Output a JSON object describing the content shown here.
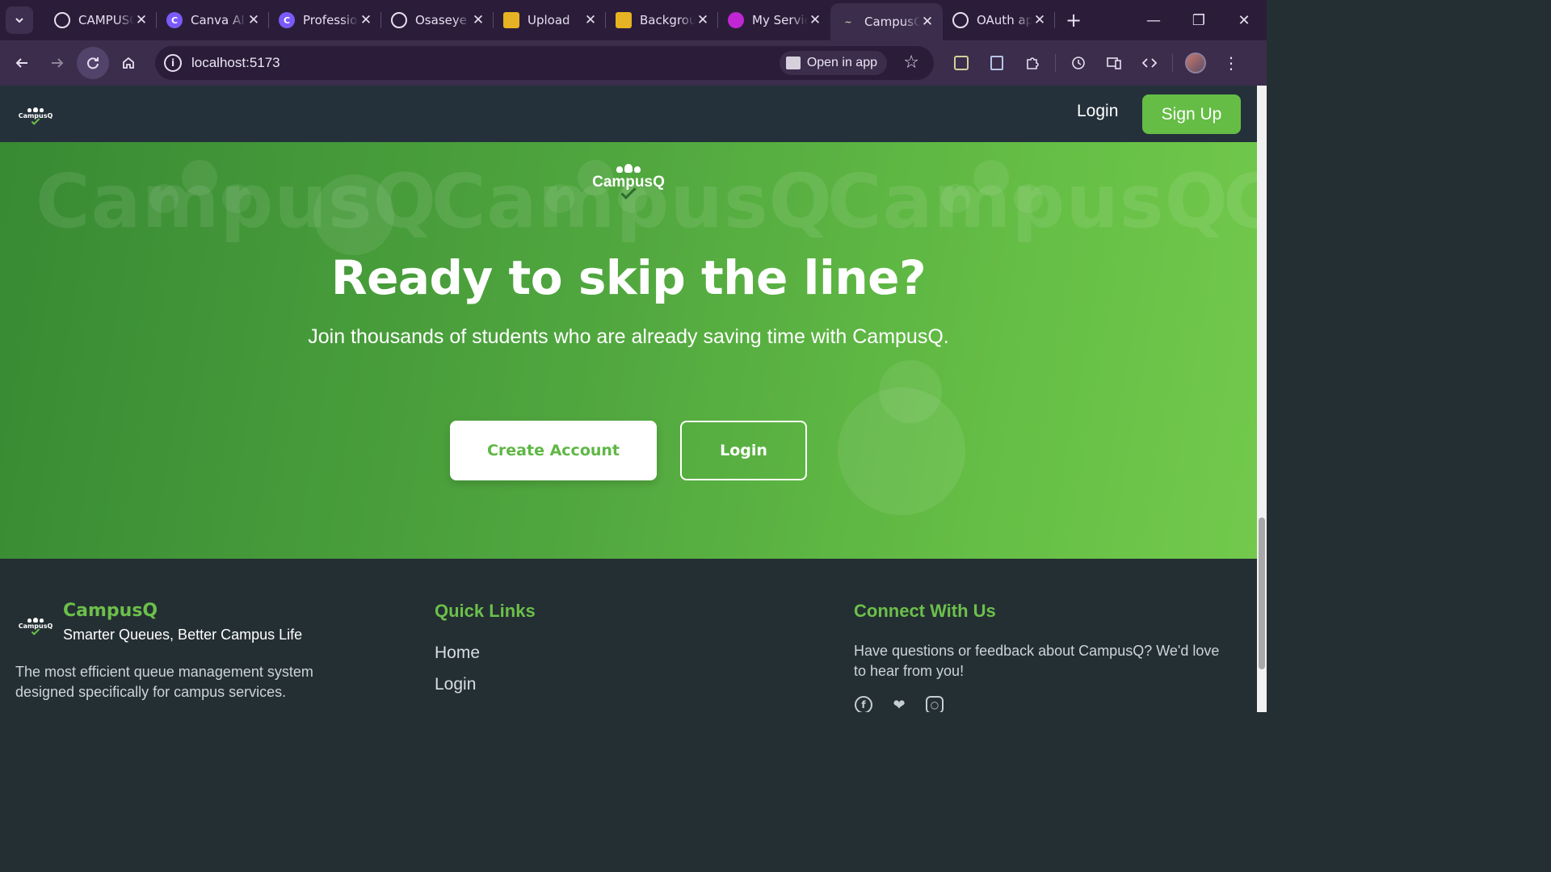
{
  "browser": {
    "tabs": [
      {
        "title": "CAMPUSQ",
        "icon": "openai-icon",
        "color": "#2b1d39"
      },
      {
        "title": "Canva AI",
        "icon": "canva-icon",
        "color": "#7a5af8"
      },
      {
        "title": "Professional",
        "icon": "canva-icon",
        "color": "#7a5af8"
      },
      {
        "title": "Osaseye",
        "icon": "github-icon",
        "color": "#2b1d39"
      },
      {
        "title": "Upload",
        "icon": "stack-icon",
        "color": "#e5b323"
      },
      {
        "title": "Background",
        "icon": "stack-icon",
        "color": "#e5b323"
      },
      {
        "title": "My Services",
        "icon": "app-icon",
        "color": "#c026d3"
      },
      {
        "title": "CampusQ",
        "icon": "campusq-icon",
        "color": "#3c2d4c",
        "active": true
      },
      {
        "title": "OAuth app",
        "icon": "github-icon",
        "color": "#2b1d39"
      }
    ],
    "url": "localhost:5173",
    "open_in_app": "Open in app"
  },
  "nav": {
    "logo_text": "CampusQ",
    "login": "Login",
    "signup": "Sign Up"
  },
  "hero": {
    "logo_text": "CampusQ",
    "watermark": "CampusQ",
    "title": "Ready to skip the line?",
    "subtitle": "Join thousands of students who are already saving time with CampusQ.",
    "create_account": "Create Account",
    "login": "Login"
  },
  "footer": {
    "logo_text": "CampusQ",
    "brand": "CampusQ",
    "tagline": "Smarter Queues, Better Campus Life",
    "description": "The most efficient queue management system designed specifically for campus services.",
    "quick_links_heading": "Quick Links",
    "quick_links": [
      "Home",
      "Login"
    ],
    "connect_heading": "Connect With Us",
    "connect_text": "Have questions or feedback about CampusQ? We'd love to hear from you!",
    "social": [
      "facebook-icon",
      "twitter-icon",
      "instagram-icon"
    ]
  },
  "colors": {
    "brand_green": "#65bd45",
    "nav_bg": "#24313a",
    "browser_frame": "#2b1d39"
  }
}
